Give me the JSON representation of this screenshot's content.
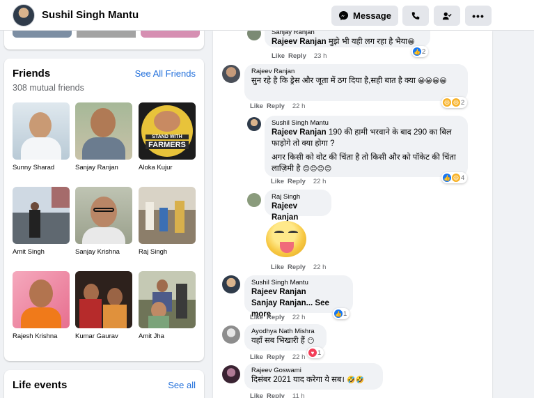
{
  "header": {
    "profile_name": "Sushil Singh Mantu",
    "message_label": "Message",
    "call_icon": "phone-icon",
    "add_friend_icon": "person-check-icon",
    "more_icon": "more-icon"
  },
  "friends": {
    "title": "Friends",
    "see_all": "See All Friends",
    "mutual": "308 mutual friends",
    "items": [
      {
        "name": "Sunny Sharad",
        "color": "#c9d7e0"
      },
      {
        "name": "Sanjay Ranjan",
        "color": "#b8c7b0"
      },
      {
        "name": "Aloka Kujur",
        "color": "#1c1c1c"
      },
      {
        "name": "Amit Singh",
        "color": "#7a8a96"
      },
      {
        "name": "Sanjay Krishna",
        "color": "#b5b9a8"
      },
      {
        "name": "Raj Singh",
        "color": "#a39a86"
      },
      {
        "name": "Rajesh Krishna",
        "color": "#e88aa0"
      },
      {
        "name": "Kumar Gaurav",
        "color": "#3b2a24"
      },
      {
        "name": "Amit Jha",
        "color": "#6b7258"
      }
    ],
    "aloka_badge_line1": "STAND WITH",
    "aloka_badge_line2": "FARMERS"
  },
  "life_events": {
    "title": "Life events",
    "see_all": "See all"
  },
  "comments": [
    {
      "author": "Sanjay Ranjan",
      "mention": "Rajeev Ranjan",
      "text": " मुझे भी यही लग रहा है भैया",
      "emoji": "😁",
      "like": "Like",
      "reply": "Reply",
      "time": "23 h",
      "reacts": "2"
    },
    {
      "author": "Rajeev Ranjan",
      "text": "सुन रहे है कि ड्रेस और जूता में ठग दिया है,सही बात है क्या ",
      "emoji": "😀😀😀😀",
      "like": "Like",
      "reply": "Reply",
      "time": "22 h",
      "reacts": "2"
    },
    {
      "author": "Sushil Singh Mantu",
      "mention": "Rajeev Ranjan",
      "text": " 190 की हामी भरवाने के बाद 290 का बिल फाड़ोगे तो क्या होगा ?",
      "text2": "अगर किसी को वोट की चिंता है तो किसी और को पॉकेट की चिंता लाज़िमी है ",
      "emoji": "😊😊😊😊",
      "like": "Like",
      "reply": "Reply",
      "time": "22 h",
      "reacts": "4"
    },
    {
      "author": "Raj Singh",
      "mention": "Rajeev Ranjan",
      "like": "Like",
      "reply": "Reply",
      "time": "22 h"
    },
    {
      "author": "Sushil Singh Mantu",
      "mention": "Rajeev Ranjan",
      "mention2": "Sanjay Ranjan",
      "see_more": "... See more",
      "like": "Like",
      "reply": "Reply",
      "time": "22 h",
      "reacts": "1"
    },
    {
      "author": "Ayodhya Nath Mishra",
      "text": "यहाँ सब भिखारी हैं ",
      "emoji": "😶",
      "like": "Like",
      "reply": "Reply",
      "time": "22 h",
      "reacts": "1"
    },
    {
      "author": "Rajeev Goswami",
      "text": "दिसंबर 2021 याद करेगा ये सब। ",
      "emoji": "🤣🤣",
      "like": "Like",
      "reply": "Reply",
      "time": "11 h"
    }
  ]
}
